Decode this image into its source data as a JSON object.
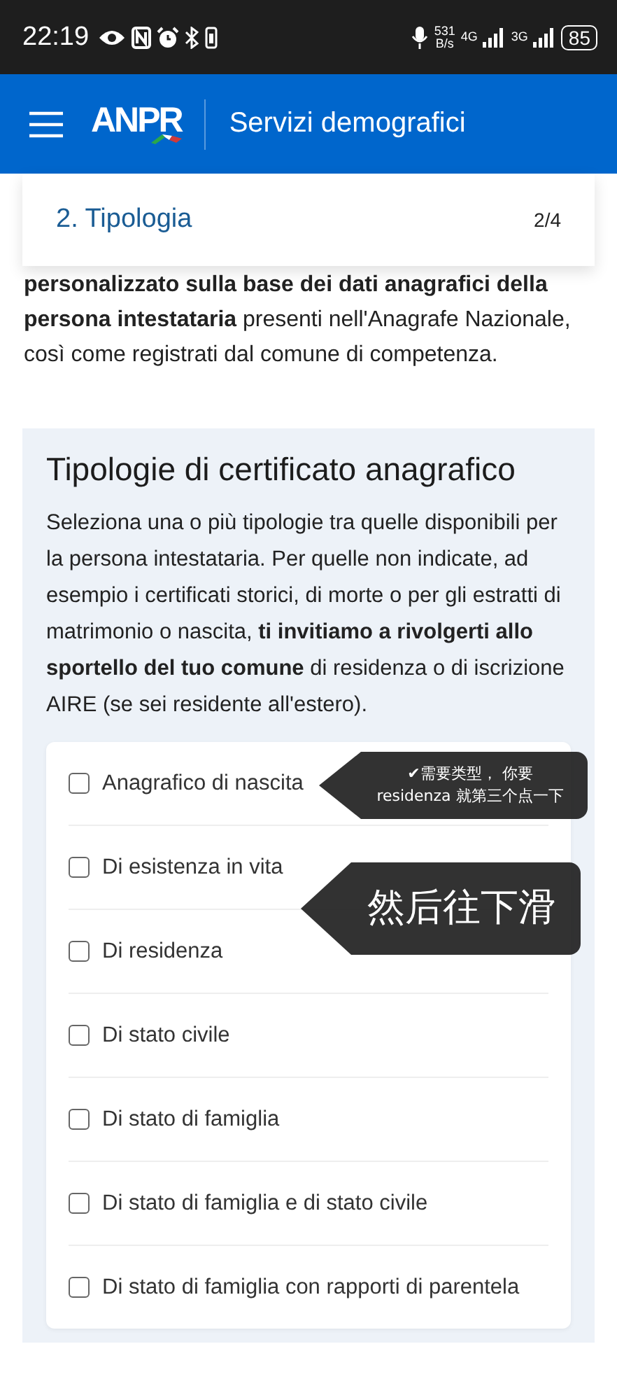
{
  "status_bar": {
    "time": "22:19",
    "net_speed": "531",
    "net_unit": "B/s",
    "sim1": "4G",
    "sim2": "3G",
    "battery": "85"
  },
  "header": {
    "logo": "ANPR",
    "title": "Servizi demografici"
  },
  "step": {
    "title": "2. Tipologia",
    "counter": "2/4"
  },
  "intro": "**personalizzato sulla base dei dati anagrafici della persona intestataria** presenti nell'Anagrafe Nazionale, così come registrati dal comune di competenza.",
  "section": {
    "title": "Tipologie di certificato anagrafico",
    "description": "Seleziona una o più tipologie tra quelle disponibili per la persona intestataria. Per quelle non indicate, ad esempio i certificati storici, di morte o per gli estratti di matrimonio o nascita, **ti invitiamo a rivolgerti allo sportello del tuo comune** di residenza o di iscrizione AIRE (se sei residente all'estero).",
    "options": [
      {
        "label": "Anagrafico di nascita",
        "checked": false
      },
      {
        "label": "Di esistenza in vita",
        "checked": false
      },
      {
        "label": "Di residenza",
        "checked": false
      },
      {
        "label": "Di stato civile",
        "checked": false
      },
      {
        "label": "Di stato di famiglia",
        "checked": false
      },
      {
        "label": "Di stato di famiglia e di stato civile",
        "checked": false
      },
      {
        "label": "Di stato di famiglia con rapporti di parentela",
        "checked": false
      }
    ]
  },
  "annotations": [
    {
      "lines": [
        "✔需要类型， 你要",
        "residenza 就第三个点一下"
      ]
    },
    {
      "lines": [
        "然后往下滑"
      ]
    }
  ]
}
